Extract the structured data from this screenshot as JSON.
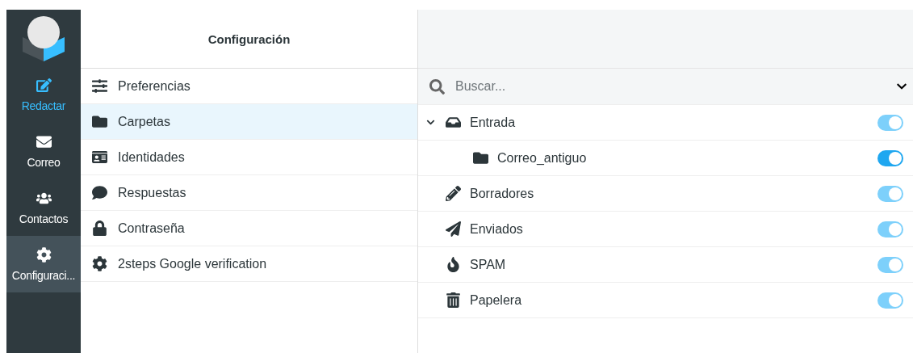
{
  "sidebar": {
    "items": [
      {
        "label": "Redactar",
        "kind": "compose",
        "selected": false,
        "highlighted": true
      },
      {
        "label": "Correo",
        "kind": "mail",
        "selected": false,
        "highlighted": false
      },
      {
        "label": "Contactos",
        "kind": "contacts",
        "selected": false,
        "highlighted": false
      },
      {
        "label": "Configuraci...",
        "kind": "settings",
        "selected": true,
        "highlighted": false
      }
    ]
  },
  "settings": {
    "title": "Configuración",
    "items": [
      {
        "label": "Preferencias",
        "kind": "sliders",
        "selected": false
      },
      {
        "label": "Carpetas",
        "kind": "folder",
        "selected": true
      },
      {
        "label": "Identidades",
        "kind": "idcard",
        "selected": false
      },
      {
        "label": "Respuestas",
        "kind": "comment",
        "selected": false
      },
      {
        "label": "Contraseña",
        "kind": "lock",
        "selected": false
      },
      {
        "label": "2steps Google verification",
        "kind": "cog",
        "selected": false
      }
    ]
  },
  "folders": {
    "search": {
      "placeholder": "Buscar..."
    },
    "items": [
      {
        "label": "Entrada",
        "kind": "inbox",
        "expanded": true,
        "on": true,
        "disabled": true,
        "children": [
          {
            "label": "Correo_antiguo",
            "kind": "folder",
            "on": true,
            "disabled": false
          }
        ]
      },
      {
        "label": "Borradores",
        "kind": "pencil",
        "on": true,
        "disabled": true
      },
      {
        "label": "Enviados",
        "kind": "plane",
        "on": true,
        "disabled": true
      },
      {
        "label": "SPAM",
        "kind": "fire",
        "on": true,
        "disabled": true
      },
      {
        "label": "Papelera",
        "kind": "trash",
        "on": true,
        "disabled": true
      }
    ]
  }
}
